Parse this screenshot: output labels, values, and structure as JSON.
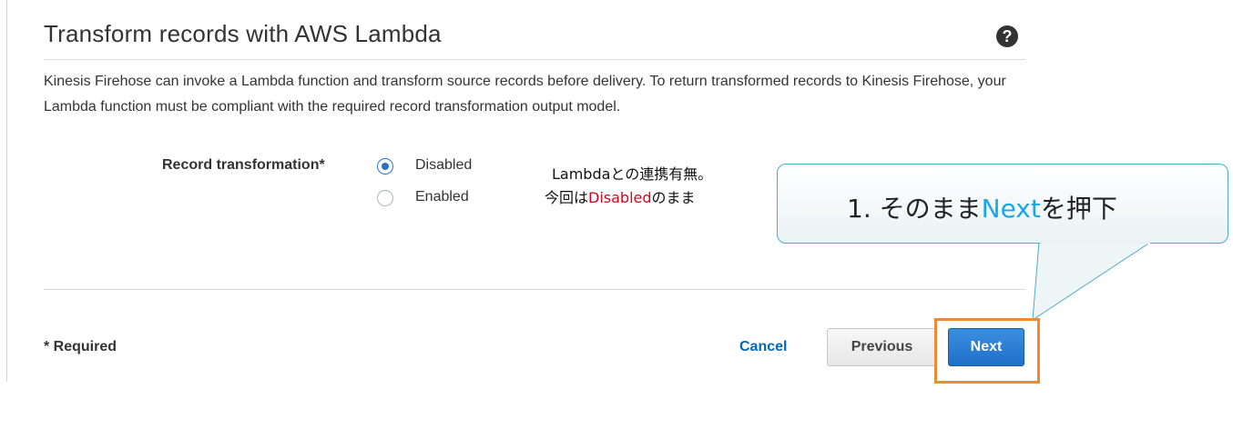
{
  "section": {
    "title": "Transform records with AWS Lambda",
    "description": "Kinesis Firehose can invoke a Lambda function and transform source records before delivery. To return transformed records to Kinesis Firehose, your Lambda function must be compliant with the required record transformation output model."
  },
  "field": {
    "label": "Record transformation*",
    "options": [
      {
        "label": "Disabled",
        "selected": true
      },
      {
        "label": "Enabled",
        "selected": false
      }
    ]
  },
  "annotation": {
    "line1": "Lambdaとの連携有無。",
    "line2_prefix": "今回は",
    "line2_highlight": "Disabled",
    "line2_suffix": "のまま"
  },
  "callout": {
    "prefix": "1. そのまま",
    "highlight": "Next",
    "suffix": "を押下"
  },
  "footer": {
    "required_note": "* Required",
    "cancel_label": "Cancel",
    "previous_label": "Previous",
    "next_label": "Next"
  },
  "colors": {
    "primary_button": "#2070c8",
    "link": "#0066c0",
    "highlight_box": "#f08a32",
    "annotation_red": "#e0001b",
    "callout_blue": "#1aa7e8"
  }
}
